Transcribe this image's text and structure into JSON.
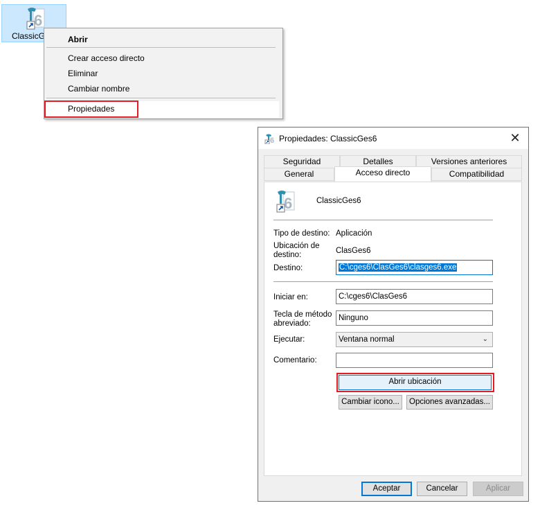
{
  "desktop": {
    "icon_label": "ClassicGes"
  },
  "context_menu": {
    "items": [
      "Abrir",
      "Crear acceso directo",
      "Eliminar",
      "Cambiar nombre",
      "Propiedades"
    ]
  },
  "dialog": {
    "title": "Propiedades: ClassicGes6",
    "close_glyph": "✕",
    "tabs_row1": [
      "Seguridad",
      "Detalles",
      "Versiones anteriores"
    ],
    "tabs_row2": [
      "General",
      "Acceso directo",
      "Compatibilidad"
    ],
    "shortcut_name": "ClassicGes6",
    "target_type_label": "Tipo de destino:",
    "target_type_value": "Aplicación",
    "target_location_label_1": "Ubicación de",
    "target_location_label_2": "destino:",
    "target_location_value": "ClasGes6",
    "target_label": "Destino:",
    "target_value": "C:\\cges6\\ClasGes6\\clasges6.exe",
    "start_in_label": "Iniciar en:",
    "start_in_value": "C:\\cges6\\ClasGes6",
    "hotkey_label_1": "Tecla de método",
    "hotkey_label_2": "abreviado:",
    "hotkey_value": "Ninguno",
    "run_label": "Ejecutar:",
    "run_value": "Ventana normal",
    "comment_label": "Comentario:",
    "comment_value": "",
    "open_location_label": "Abrir ubicación",
    "change_icon_label": "Cambiar icono...",
    "advanced_label": "Opciones avanzadas...",
    "ok_label": "Aceptar",
    "cancel_label": "Cancelar",
    "apply_label": "Aplicar"
  },
  "colors": {
    "highlight_red": "#e31c23",
    "accent_blue": "#0078d7",
    "icon_teal": "#2f8fb0"
  }
}
